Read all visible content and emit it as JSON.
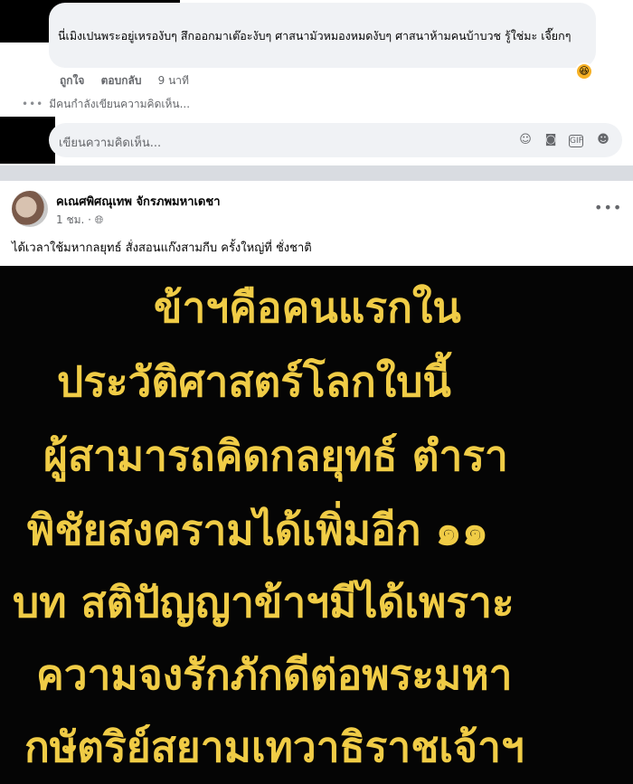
{
  "comment": {
    "text": "นี่เมิงเปนพระอยู่เหรองับๆ สึกออกมาเต๊อะงับๆ ศาสนามัวหมองหมดงับๆ ศาสนาห้ามคนบ้าบวช รู้ใช่มะ เจี๊ยกๆ",
    "reaction_emoji": "😆",
    "like_label": "ถูกใจ",
    "reply_label": "ตอบกลับ",
    "time": "9 นาที"
  },
  "typing_indicator": "มีคนกำลังเขียนความคิดเห็น...",
  "comment_input": {
    "placeholder": "เขียนความคิดเห็น...",
    "icons": [
      "emoji-icon",
      "camera-icon",
      "gif-icon",
      "sticker-icon"
    ]
  },
  "post": {
    "author": "คเณศพิศณุเทพ จักรภพมหาเดชา",
    "time": "1 ชม.",
    "privacy_icon": "globe-icon",
    "caption": "ได้เวลาใช้มหากลยุทธ์ สั่งสอนแก๊งสามกีบ ครั้งใหญ่ที่ ชั่งชาติ",
    "image_lines": [
      "ข้าฯคือคนแรกใน",
      "ประวัติศาสตร์โลกใบนี้",
      "ผู้สามารถคิดกลยุทธ์ ตำรา",
      "พิชัยสงครามได้เพิ่มอีก ๑๑",
      "บท สติปัญญาข้าฯมีได้เพราะ",
      "ความจงรักภักดีต่อพระมหา",
      "กษัตริย์สยามเทวาธิราชเจ้าฯ"
    ],
    "image_text_color": "#f0cc46"
  }
}
